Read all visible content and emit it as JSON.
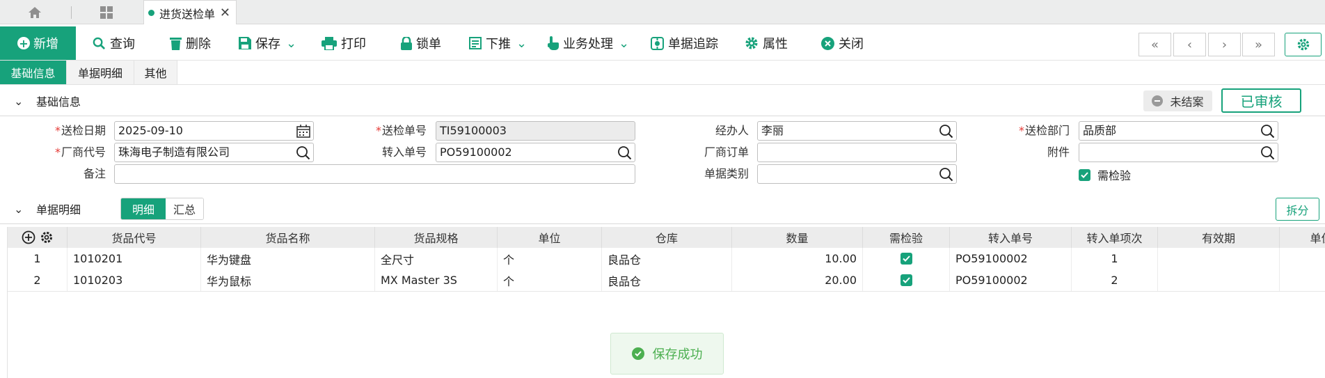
{
  "tabs": {
    "active_label": "进货送检单",
    "close_glyph": "✕"
  },
  "toolbar": {
    "new": "新增",
    "query": "查询",
    "delete": "删除",
    "save": "保存",
    "print": "打印",
    "lock": "锁单",
    "push_down": "下推",
    "business": "业务处理",
    "trace": "单据追踪",
    "properties": "属性",
    "close": "关闭",
    "nav": [
      "«",
      "‹",
      "›",
      "»"
    ]
  },
  "subtabs": [
    "基础信息",
    "单据明细",
    "其他"
  ],
  "basic": {
    "title": "基础信息",
    "status_open": "未结案",
    "status_audit": "已审核",
    "fields": {
      "inspect_date": {
        "label": "送检日期",
        "value": "2025-09-10"
      },
      "inspect_no": {
        "label": "送检单号",
        "value": "TI59100003"
      },
      "handler": {
        "label": "经办人",
        "value": "李丽"
      },
      "inspect_dept": {
        "label": "送检部门",
        "value": "品质部"
      },
      "vendor_code": {
        "label": "厂商代号",
        "value": "珠海电子制造有限公司"
      },
      "source_no": {
        "label": "转入单号",
        "value": "PO59100002"
      },
      "vendor_order": {
        "label": "厂商订单",
        "value": ""
      },
      "attachment": {
        "label": "附件",
        "value": ""
      },
      "remark": {
        "label": "备注",
        "value": ""
      },
      "doc_type": {
        "label": "单据类别",
        "value": ""
      },
      "need_inspect": {
        "label": "需检验",
        "checked": true
      }
    }
  },
  "detail": {
    "title": "单据明细",
    "view_detail": "明细",
    "view_summary": "汇总",
    "split": "拆分",
    "columns": [
      "货品代号",
      "货品名称",
      "货品规格",
      "单位",
      "仓库",
      "数量",
      "需检验",
      "转入单号",
      "转入单项次",
      "有效期",
      "单位"
    ],
    "rows": [
      {
        "no": "1",
        "code": "1010201",
        "name": "华为键盘",
        "spec": "全尺寸",
        "unit": "个",
        "warehouse": "良品仓",
        "qty": "10.00",
        "need": true,
        "src_no": "PO59100002",
        "src_line": "1",
        "expiry": ""
      },
      {
        "no": "2",
        "code": "1010203",
        "name": "华为鼠标",
        "spec": "MX Master 3S",
        "unit": "个",
        "warehouse": "良品仓",
        "qty": "20.00",
        "need": true,
        "src_no": "PO59100002",
        "src_line": "2",
        "expiry": ""
      }
    ]
  },
  "toast": {
    "message": "保存成功"
  },
  "colors": {
    "accent": "#17a27b",
    "required": "#e53935",
    "success": "#4caf50"
  }
}
